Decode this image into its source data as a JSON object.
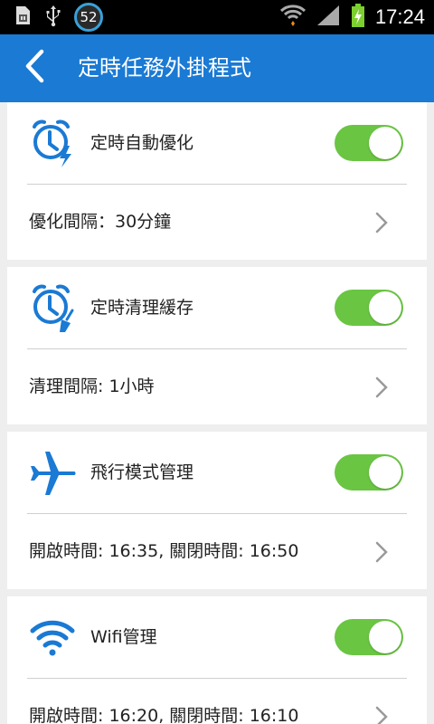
{
  "status_bar": {
    "notification_count": "52",
    "time": "17:24",
    "icons": [
      "sim-card-icon",
      "usb-icon",
      "wifi-icon",
      "signal-icon",
      "battery-charging-icon"
    ]
  },
  "header": {
    "title": "定時任務外掛程式",
    "back_icon": "chevron-left-icon"
  },
  "colors": {
    "app_bar": "#1a7ad4",
    "toggle_on": "#6ac543",
    "icon_blue": "#1a7ad4"
  },
  "tasks": [
    {
      "title": "定時自動優化",
      "enabled": true,
      "detail": "優化間隔：30分鐘",
      "icon": "alarm-bolt-icon"
    },
    {
      "title": "定時清理緩存",
      "enabled": true,
      "detail": "清理間隔: 1小時",
      "icon": "alarm-broom-icon"
    },
    {
      "title": "飛行模式管理",
      "enabled": true,
      "detail": "開啟時間: 16:35, 關閉時間: 16:50",
      "icon": "airplane-icon"
    },
    {
      "title": "Wifi管理",
      "enabled": true,
      "detail": "開啟時間: 16:20, 關閉時間: 16:10",
      "icon": "wifi-icon"
    }
  ]
}
